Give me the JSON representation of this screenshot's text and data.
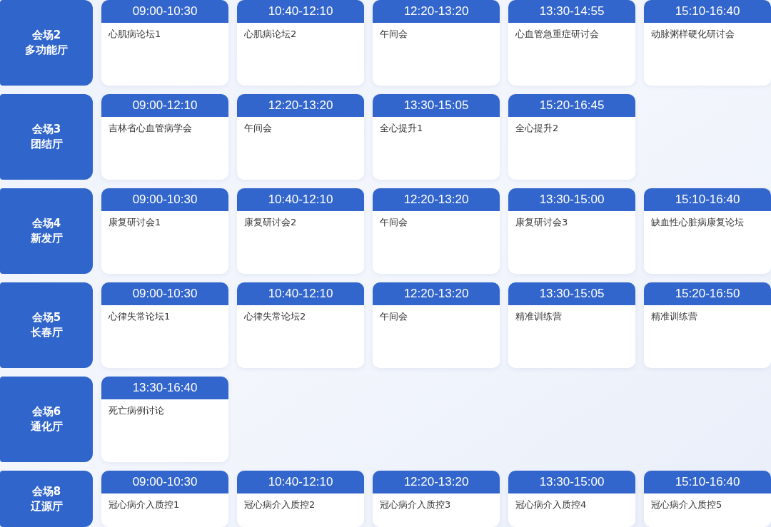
{
  "rooms": [
    {
      "name": "会场2",
      "hall": "多功能厅",
      "sessions": [
        {
          "time": "09:00-10:30",
          "title": "心肌病论坛1"
        },
        {
          "time": "10:40-12:10",
          "title": "心肌病论坛2"
        },
        {
          "time": "12:20-13:20",
          "title": "午间会"
        },
        {
          "time": "13:30-14:55",
          "title": "心血管急重症研讨会"
        },
        {
          "time": "15:10-16:40",
          "title": "动脉粥样硬化研讨会"
        }
      ]
    },
    {
      "name": "会场3",
      "hall": "团结厅",
      "sessions": [
        {
          "time": "09:00-12:10",
          "title": "吉林省心血管病学会"
        },
        {
          "time": "12:20-13:20",
          "title": "午间会"
        },
        {
          "time": "13:30-15:05",
          "title": "全心提升1"
        },
        {
          "time": "15:20-16:45",
          "title": "全心提升2"
        }
      ]
    },
    {
      "name": "会场4",
      "hall": "新发厅",
      "sessions": [
        {
          "time": "09:00-10:30",
          "title": "康复研讨会1"
        },
        {
          "time": "10:40-12:10",
          "title": "康复研讨会2"
        },
        {
          "time": "12:20-13:20",
          "title": "午间会"
        },
        {
          "time": "13:30-15:00",
          "title": "康复研讨会3"
        },
        {
          "time": "15:10-16:40",
          "title": "缺血性心脏病康复论坛"
        }
      ]
    },
    {
      "name": "会场5",
      "hall": "长春厅",
      "sessions": [
        {
          "time": "09:00-10:30",
          "title": "心律失常论坛1"
        },
        {
          "time": "10:40-12:10",
          "title": "心律失常论坛2"
        },
        {
          "time": "12:20-13:20",
          "title": "午间会"
        },
        {
          "time": "13:30-15:05",
          "title": "精准训练营"
        },
        {
          "time": "15:20-16:50",
          "title": "精准训练营"
        }
      ]
    },
    {
      "name": "会场6",
      "hall": "通化厅",
      "sessions": [
        {
          "time": "13:30-16:40",
          "title": "死亡病例讨论"
        }
      ]
    },
    {
      "name": "会场8",
      "hall": "辽源厅",
      "sessions": [
        {
          "time": "09:00-10:30",
          "title": "冠心病介入质控1"
        },
        {
          "time": "10:40-12:10",
          "title": "冠心病介入质控2"
        },
        {
          "time": "12:20-13:20",
          "title": "冠心病介入质控3"
        },
        {
          "time": "13:30-15:00",
          "title": "冠心病介入质控4"
        },
        {
          "time": "15:10-16:40",
          "title": "冠心病介入质控5"
        }
      ]
    }
  ]
}
